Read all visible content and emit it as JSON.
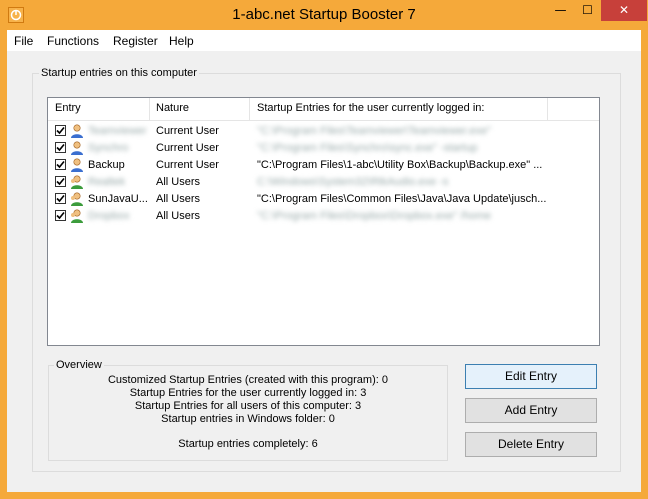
{
  "window": {
    "title": "1-abc.net Startup Booster 7",
    "controls": {
      "minimize": "—",
      "maximize": "☐",
      "close": "✕"
    }
  },
  "menu": [
    "File",
    "Functions",
    "Register",
    "Help"
  ],
  "main_group": {
    "label": "Startup entries on this computer",
    "columns": [
      "Entry",
      "Nature",
      "Startup Entries for the user currently logged in:"
    ],
    "rows": [
      {
        "checked": true,
        "icon": "user-icon",
        "entry": "Teamviewer",
        "nature": "Current User",
        "path": "\"C:\\Program Files\\Teamviewer\\Teamviewer.exe\""
      },
      {
        "checked": true,
        "icon": "user-icon",
        "entry": "Synchro",
        "nature": "Current User",
        "path": "\"C:\\Program Files\\Synchro\\sync.exe\" -startup"
      },
      {
        "checked": true,
        "icon": "user-icon",
        "entry": "Backup",
        "nature": "Current User",
        "path": "\"C:\\Program Files\\1-abc\\Utility Box\\Backup\\Backup.exe\" ..."
      },
      {
        "checked": true,
        "icon": "all-users-icon",
        "entry": "Realtek",
        "nature": "All Users",
        "path": "C:\\Windows\\System32\\RtkAudio.exe -s"
      },
      {
        "checked": true,
        "icon": "all-users-icon",
        "entry": "SunJavaU...",
        "nature": "All Users",
        "path": "\"C:\\Program Files\\Common Files\\Java\\Java Update\\jusch..."
      },
      {
        "checked": true,
        "icon": "all-users-icon",
        "entry": "Dropbox",
        "nature": "All Users",
        "path": "\"C:\\Program Files\\Dropbox\\Dropbox.exe\" /home"
      }
    ]
  },
  "overview": {
    "label": "Overview",
    "lines": [
      "Customized Startup Entries (created with this program): 0",
      "Startup Entries for the user currently logged in: 3",
      "Startup Entries for all users of this computer: 3",
      "Startup entries in Windows folder: 0",
      "",
      "Startup entries completely: 6"
    ]
  },
  "buttons": {
    "edit": "Edit Entry",
    "add": "Add Entry",
    "delete": "Delete Entry"
  },
  "colors": {
    "frame": "#f5a93a",
    "close": "#c7403a",
    "accent": "#3c7fb1"
  }
}
